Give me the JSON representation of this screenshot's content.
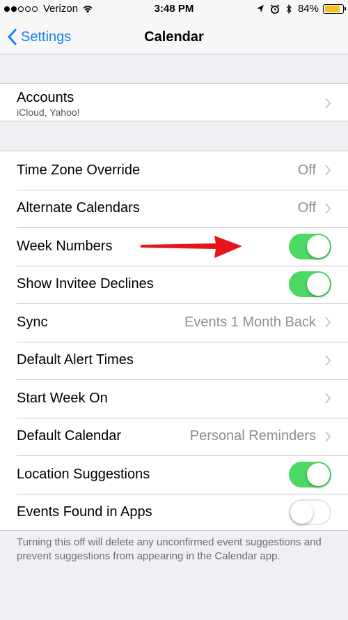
{
  "status_bar": {
    "carrier": "Verizon",
    "time": "3:48 PM",
    "battery_percent": "84%",
    "battery_level": 0.84,
    "signal_bars_filled": 2,
    "signal_bars_total": 5
  },
  "nav": {
    "back_label": "Settings",
    "title": "Calendar"
  },
  "accounts": {
    "label": "Accounts",
    "subtitle": "iCloud, Yahoo!"
  },
  "rows": [
    {
      "label": "Time Zone Override",
      "value": "Off",
      "type": "disclosure"
    },
    {
      "label": "Alternate Calendars",
      "value": "Off",
      "type": "disclosure"
    },
    {
      "label": "Week Numbers",
      "type": "toggle",
      "on": true
    },
    {
      "label": "Show Invitee Declines",
      "type": "toggle",
      "on": true
    },
    {
      "label": "Sync",
      "value": "Events 1 Month Back",
      "type": "disclosure"
    },
    {
      "label": "Default Alert Times",
      "value": "",
      "type": "disclosure"
    },
    {
      "label": "Start Week On",
      "value": "",
      "type": "disclosure"
    },
    {
      "label": "Default Calendar",
      "value": "Personal Reminders",
      "type": "disclosure"
    },
    {
      "label": "Location Suggestions",
      "type": "toggle",
      "on": true
    },
    {
      "label": "Events Found in Apps",
      "type": "toggle",
      "on": false
    }
  ],
  "footer_note": "Turning this off will delete any unconfirmed event suggestions and prevent suggestions from appearing in the Calendar app.",
  "colors": {
    "accent": "#1d7ef6",
    "toggle_on": "#4cd964",
    "battery": "#f5c11a",
    "annotation_arrow": "#e8141b"
  }
}
